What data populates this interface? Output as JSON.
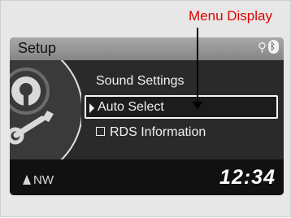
{
  "callout": {
    "label": "Menu Display"
  },
  "screen": {
    "title": "Setup",
    "status_icons": [
      "usb-icon",
      "bluetooth-icon"
    ],
    "usb_glyph": "ψ",
    "bt_glyph": "β",
    "menu": {
      "items": [
        {
          "label": "Sound Settings",
          "selected": false,
          "checkbox": false
        },
        {
          "label": "Auto Select",
          "selected": true,
          "checkbox": false
        },
        {
          "label": "RDS Information",
          "selected": false,
          "checkbox": true,
          "checked": false
        }
      ]
    },
    "compass": {
      "heading": "NW"
    },
    "clock": {
      "time": "12:34"
    }
  },
  "colors": {
    "callout": "#e00000",
    "screen_bg": "#1e1e1e",
    "title_bar": "#969696",
    "selection_border": "#f5f5f5"
  }
}
